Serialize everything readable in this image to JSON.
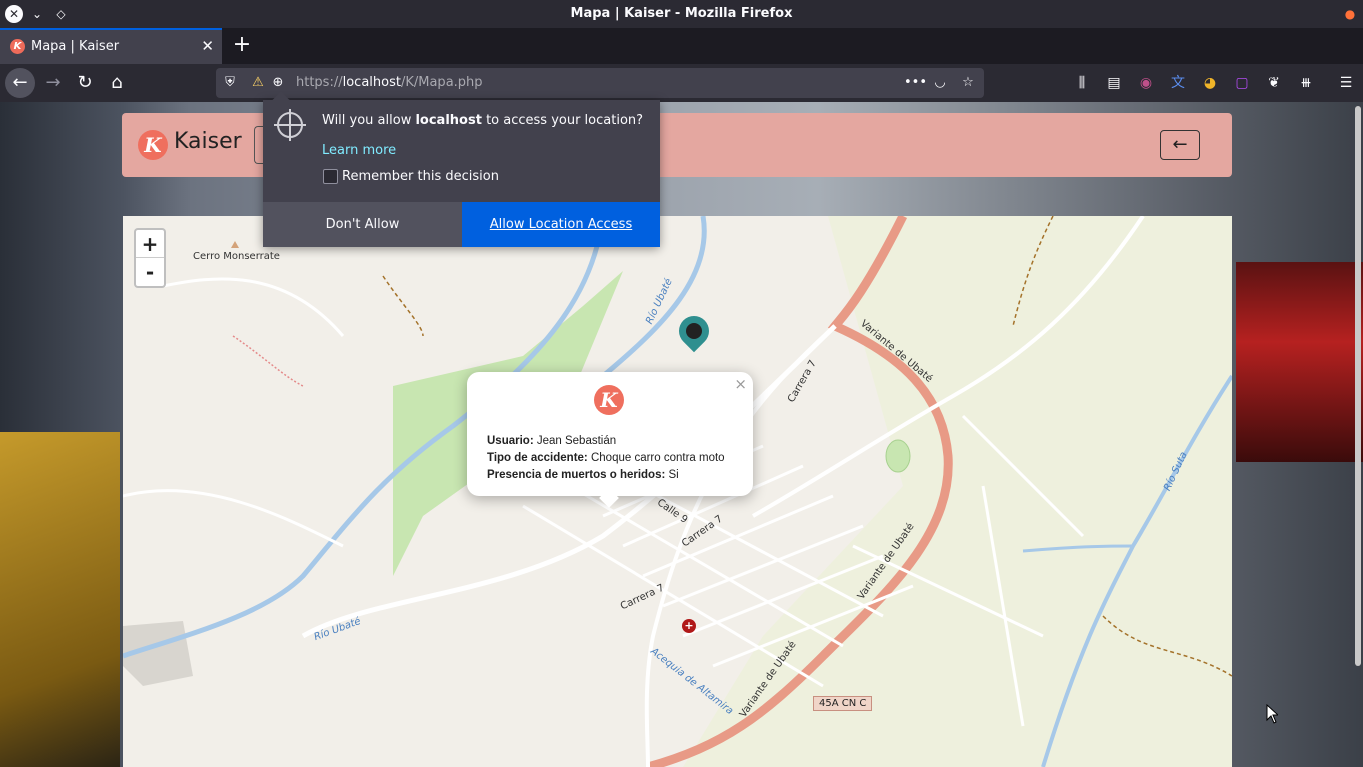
{
  "window": {
    "title": "Mapa | Kaiser - Mozilla Firefox"
  },
  "tab": {
    "title": "Mapa | Kaiser",
    "favicon_letter": "K"
  },
  "urlbar": {
    "protocol": "https://",
    "host": "localhost",
    "path": "/K/Mapa.php"
  },
  "permission": {
    "question_pre": "Will you allow ",
    "question_host": "localhost",
    "question_post": " to access your location?",
    "learn_more": "Learn more",
    "remember": "Remember this decision",
    "deny_label": "Don't Allow",
    "allow_label": "Allow Location Access"
  },
  "header": {
    "brand_letter": "K",
    "brand_name": "Kaiser"
  },
  "map": {
    "zoom_in": "+",
    "zoom_out": "-",
    "labels": {
      "peak": "Cerro Monserrate",
      "river1": "Río Ubaté",
      "river2": "Río Ubaté",
      "river3": "Río Suta",
      "road1": "Variante de Ubaté",
      "road2": "Variante de Ubaté",
      "road3": "Variante de Ubaté",
      "carrera7a": "Carrera 7",
      "carrera7b": "Carrera 7",
      "carrera7c": "Carrera 7",
      "calle9": "Calle 9",
      "acequia": "Acequia de Altamira",
      "route": "45A CN C"
    }
  },
  "popup": {
    "logo_letter": "K",
    "usuario_label": "Usuario:",
    "usuario_value": "Jean Sebastián",
    "tipo_label": "Tipo de accidente:",
    "tipo_value": "Choque carro contra moto",
    "presencia_label": "Presencia de muertos o heridos:",
    "presencia_value": "Si"
  },
  "colors": {
    "accent": "#0060df",
    "brand": "#ef6f5e",
    "header_bg": "#e4a7a0",
    "marker": "#2f8f8f"
  }
}
